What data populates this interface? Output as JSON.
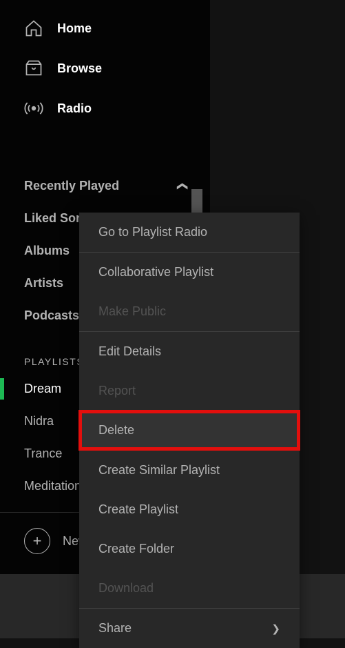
{
  "nav": {
    "home": "Home",
    "browse": "Browse",
    "radio": "Radio"
  },
  "library": {
    "recently_played": "Recently Played",
    "liked_songs": "Liked Songs",
    "albums": "Albums",
    "artists": "Artists",
    "podcasts": "Podcasts"
  },
  "playlists": {
    "header": "PLAYLISTS",
    "items": [
      "Dream",
      "Nidra",
      "Trance",
      "Meditation"
    ]
  },
  "new_playlist": "New Playlist",
  "context_menu": {
    "playlist_radio": "Go to Playlist Radio",
    "collaborative": "Collaborative Playlist",
    "make_public": "Make Public",
    "edit_details": "Edit Details",
    "report": "Report",
    "delete": "Delete",
    "create_similar": "Create Similar Playlist",
    "create_playlist": "Create Playlist",
    "create_folder": "Create Folder",
    "download": "Download",
    "share": "Share"
  }
}
